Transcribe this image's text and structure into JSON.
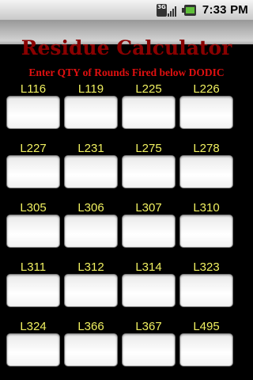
{
  "status_bar": {
    "time": "7:33 PM",
    "network_label": "3G"
  },
  "app": {
    "title": "Residue Calculator",
    "subtitle": "Enter QTY of Rounds Fired below DODIC"
  },
  "dodics": [
    "L116",
    "L119",
    "L225",
    "L226",
    "L227",
    "L231",
    "L275",
    "L278",
    "L305",
    "L306",
    "L307",
    "L310",
    "L311",
    "L312",
    "L314",
    "L323",
    "L324",
    "L366",
    "L367",
    "L495"
  ],
  "colors": {
    "label": "#f0f060",
    "subtitle": "#e01010",
    "title": "#8a0000",
    "background": "#000000"
  }
}
